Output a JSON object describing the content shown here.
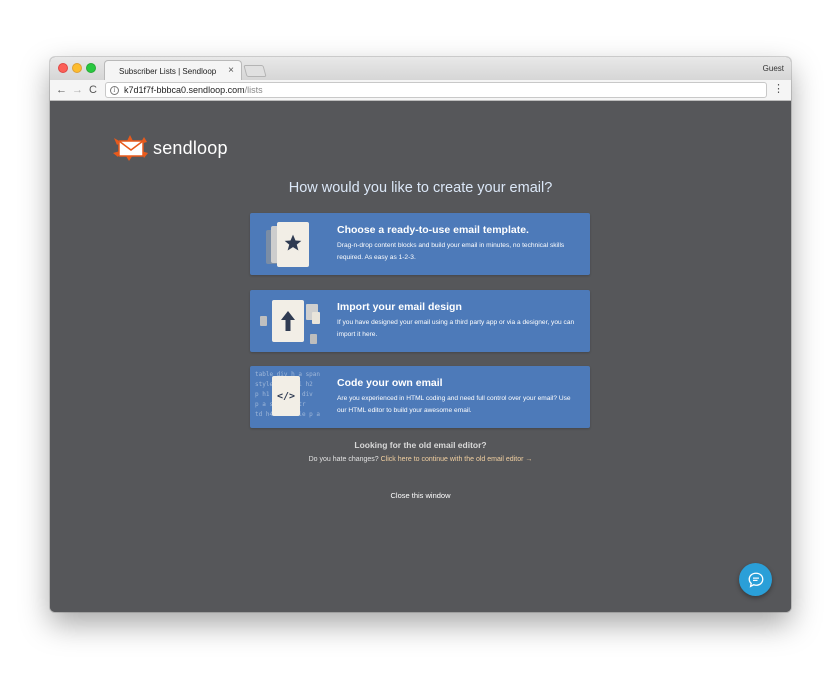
{
  "browser": {
    "tab_title": "Subscriber Lists | Sendloop",
    "tab_close": "×",
    "profile": "Guest",
    "url_host": "k7d1f7f-bbbca0.sendloop.com",
    "url_path": "/lists",
    "back_glyph": "←",
    "forward_glyph": "→",
    "reload_glyph": "C",
    "menu_glyph": "⋮",
    "info_glyph": "i"
  },
  "brand": {
    "name": "sendloop",
    "logo_color": "#e85a1c"
  },
  "heading": "How would you like to create your email?",
  "options": [
    {
      "title": "Choose a ready-to-use email template.",
      "description": "Drag-n-drop content blocks and build your email in minutes, no technical skills required. As easy as 1-2-3.",
      "icon": "star-icon"
    },
    {
      "title": "Import your email design",
      "description": "If you have designed your email using a third party app or via a designer, you can import it here.",
      "icon": "upload-arrow-icon"
    },
    {
      "title": "Code your own email",
      "description": "Are you experienced in HTML coding and need full control over your email? Use our HTML editor to build your awesome email.",
      "icon": "code-icon",
      "code_snippet": "table div h a span\nstyle p b u l h2\np h1 h3 h4 b div\np a span h5 tr\ntd h4 h1 table p a",
      "code_glyph": "</>"
    }
  ],
  "old_editor": {
    "title": "Looking for the old email editor?",
    "prefix": "Do you hate changes? ",
    "link": "Click here to continue with the old email editor →"
  },
  "close_window": "Close this window",
  "colors": {
    "background": "#56575a",
    "card": "#4d7ab9",
    "heading": "#dbe7f7",
    "link": "#f1cfa0",
    "chat": "#2a9fd8"
  }
}
